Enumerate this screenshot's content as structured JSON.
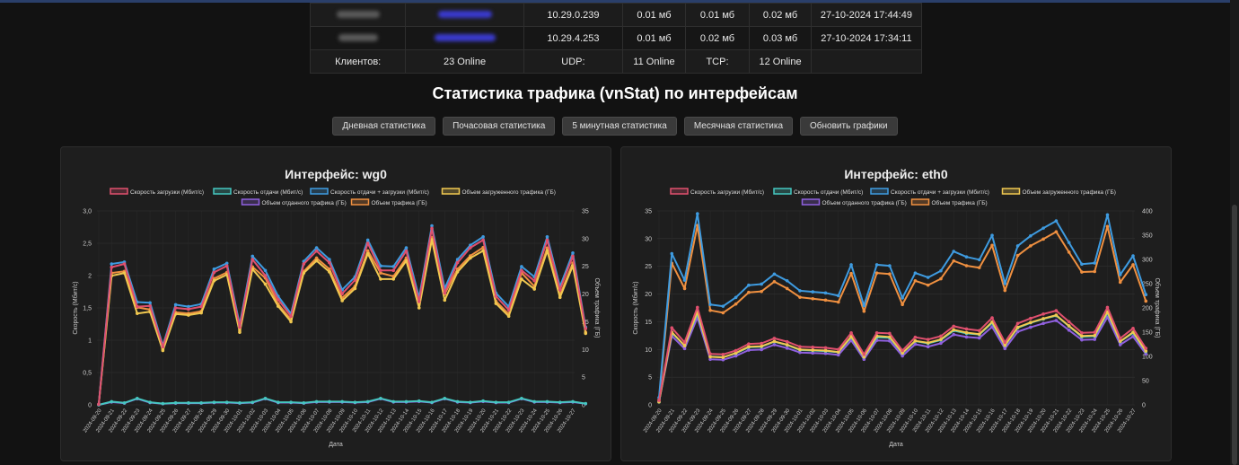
{
  "clients_table": {
    "rows": [
      {
        "ip": "10.29.0.239",
        "download": "0.01 мб",
        "upload": "0.01 мб",
        "total": "0.02 мб",
        "last_seen": "27-10-2024 17:44:49"
      },
      {
        "ip": "10.29.4.253",
        "download": "0.01 мб",
        "upload": "0.02 мб",
        "total": "0.03 мб",
        "last_seen": "27-10-2024 17:34:11"
      }
    ],
    "summary": {
      "clients_label": "Клиентов:",
      "clients_value": "23 Online",
      "udp_label": "UDP:",
      "udp_value": "11 Online",
      "tcp_label": "TCP:",
      "tcp_value": "12 Online"
    }
  },
  "section_title": "Статистика трафика (vnStat) по интерфейсам",
  "buttons": {
    "daily": "Дневная статистика",
    "hourly": "Почасовая статистика",
    "five_min": "5 минутная статистика",
    "monthly": "Месячная статистика",
    "refresh": "Обновить графики"
  },
  "colors": {
    "download": "#e0506e",
    "upload": "#45c7c0",
    "total_speed": "#3e9be0",
    "vol_download": "#f0c850",
    "vol_upload": "#9060e0",
    "vol_total": "#f09040"
  },
  "chart_data": [
    {
      "type": "line",
      "title": "Интерфейс: wg0",
      "xlabel": "Дата",
      "ylabel": "Скорость (Мбит/с)",
      "y2label": "Объем трафика (ГБ)",
      "ylim": [
        0,
        3.0
      ],
      "y2lim": [
        0,
        35
      ],
      "yticks": [
        "0",
        "0,5",
        "1",
        "1,5",
        "2",
        "2,5",
        "3,0"
      ],
      "y2ticks": [
        "0",
        "5",
        "10",
        "15",
        "20",
        "25",
        "30",
        "35"
      ],
      "legend": "top",
      "categories": [
        "2024-09-20",
        "2024-09-21",
        "2024-09-22",
        "2024-09-23",
        "2024-09-24",
        "2024-09-25",
        "2024-09-26",
        "2024-09-27",
        "2024-09-28",
        "2024-09-29",
        "2024-09-30",
        "2024-10-01",
        "2024-10-02",
        "2024-10-03",
        "2024-10-04",
        "2024-10-05",
        "2024-10-06",
        "2024-10-07",
        "2024-10-08",
        "2024-10-09",
        "2024-10-10",
        "2024-10-11",
        "2024-10-12",
        "2024-10-13",
        "2024-10-14",
        "2024-10-15",
        "2024-10-16",
        "2024-10-17",
        "2024-10-18",
        "2024-10-19",
        "2024-10-20",
        "2024-10-21",
        "2024-10-22",
        "2024-10-23",
        "2024-10-24",
        "2024-10-25",
        "2024-10-26",
        "2024-10-27"
      ],
      "series": [
        {
          "name": "Скорость загрузки (Мбит/с)",
          "axis": "left",
          "color": "#e0506e",
          "values": [
            0.01,
            2.13,
            2.18,
            1.52,
            1.53,
            0.9,
            1.5,
            1.48,
            1.52,
            2.05,
            2.15,
            1.2,
            2.25,
            2.0,
            1.63,
            1.37,
            2.18,
            2.38,
            2.2,
            1.72,
            1.93,
            2.5,
            2.08,
            2.08,
            2.38,
            1.6,
            2.73,
            1.73,
            2.2,
            2.43,
            2.55,
            1.68,
            1.47,
            2.08,
            1.92,
            2.55,
            1.78,
            2.3,
            1.18
          ]
        },
        {
          "name": "Скорость отдачи (Мбит/с)",
          "axis": "left",
          "color": "#45c7c0",
          "values": [
            0.0,
            0.05,
            0.03,
            0.1,
            0.04,
            0.02,
            0.03,
            0.03,
            0.03,
            0.04,
            0.04,
            0.03,
            0.04,
            0.1,
            0.04,
            0.04,
            0.03,
            0.05,
            0.05,
            0.05,
            0.04,
            0.05,
            0.1,
            0.05,
            0.05,
            0.06,
            0.04,
            0.1,
            0.05,
            0.04,
            0.06,
            0.04,
            0.04,
            0.1,
            0.05,
            0.05,
            0.04,
            0.05,
            0.02
          ]
        },
        {
          "name": "Скорость отдачи + загрузки (Мбит/с)",
          "axis": "left",
          "color": "#3e9be0",
          "values": [
            0.01,
            2.18,
            2.21,
            1.59,
            1.58,
            0.92,
            1.55,
            1.52,
            1.56,
            2.1,
            2.19,
            1.24,
            2.3,
            2.08,
            1.68,
            1.41,
            2.22,
            2.43,
            2.25,
            1.78,
            1.98,
            2.55,
            2.15,
            2.14,
            2.43,
            1.66,
            2.77,
            1.8,
            2.25,
            2.47,
            2.6,
            1.73,
            1.52,
            2.14,
            1.98,
            2.6,
            1.83,
            2.35,
            1.2
          ]
        },
        {
          "name": "Объем загруженного трафика (ГБ)",
          "axis": "right",
          "color": "#f0c850",
          "values": [
            0.1,
            23.3,
            23.8,
            16.5,
            16.8,
            9.8,
            16.4,
            16.2,
            16.6,
            22.4,
            23.5,
            13.1,
            24.5,
            21.8,
            17.8,
            15.0,
            23.8,
            26.0,
            24.0,
            18.8,
            21.0,
            27.3,
            22.7,
            22.7,
            26.0,
            17.5,
            29.8,
            18.9,
            24.0,
            26.5,
            27.8,
            18.3,
            16.0,
            22.7,
            20.9,
            27.8,
            19.4,
            25.1,
            12.9
          ]
        },
        {
          "name": "Объем отданного трафика (ГБ)",
          "axis": "right",
          "color": "#9060e0",
          "values": [
            0.0,
            0.5,
            0.3,
            1.1,
            0.4,
            0.2,
            0.3,
            0.3,
            0.3,
            0.4,
            0.4,
            0.3,
            0.4,
            1.1,
            0.4,
            0.4,
            0.3,
            0.5,
            0.5,
            0.5,
            0.4,
            0.5,
            1.1,
            0.5,
            0.5,
            0.6,
            0.4,
            1.1,
            0.5,
            0.4,
            0.6,
            0.4,
            0.4,
            1.1,
            0.5,
            0.5,
            0.4,
            0.5,
            0.2
          ]
        },
        {
          "name": "Объем трафика (ГБ)",
          "axis": "right",
          "color": "#f09040",
          "values": [
            0.1,
            23.8,
            24.1,
            17.6,
            17.2,
            10.0,
            16.7,
            16.5,
            16.9,
            22.8,
            23.9,
            13.4,
            24.9,
            22.9,
            18.2,
            15.4,
            24.1,
            26.5,
            24.5,
            19.3,
            21.4,
            27.8,
            23.8,
            23.2,
            26.5,
            18.1,
            30.2,
            20.0,
            24.5,
            26.9,
            28.4,
            18.7,
            16.4,
            23.8,
            21.4,
            28.3,
            19.8,
            25.6,
            13.1
          ]
        }
      ]
    },
    {
      "type": "line",
      "title": "Интерфейс: eth0",
      "xlabel": "Дата",
      "ylabel": "Скорость (Мбит/с)",
      "y2label": "Объем трафика (ГБ)",
      "ylim": [
        0,
        35
      ],
      "y2lim": [
        0,
        400
      ],
      "yticks": [
        "0",
        "5",
        "10",
        "15",
        "20",
        "25",
        "30",
        "35"
      ],
      "y2ticks": [
        "0",
        "50",
        "100",
        "150",
        "200",
        "250",
        "300",
        "350",
        "400"
      ],
      "legend": "top",
      "categories": [
        "2024-09-20",
        "2024-09-21",
        "2024-09-22",
        "2024-09-23",
        "2024-09-24",
        "2024-09-25",
        "2024-09-26",
        "2024-09-27",
        "2024-09-28",
        "2024-09-29",
        "2024-09-30",
        "2024-10-01",
        "2024-10-02",
        "2024-10-03",
        "2024-10-04",
        "2024-10-05",
        "2024-10-06",
        "2024-10-07",
        "2024-10-08",
        "2024-10-09",
        "2024-10-10",
        "2024-10-11",
        "2024-10-12",
        "2024-10-13",
        "2024-10-14",
        "2024-10-15",
        "2024-10-16",
        "2024-10-17",
        "2024-10-18",
        "2024-10-19",
        "2024-10-20",
        "2024-10-21",
        "2024-10-22",
        "2024-10-23",
        "2024-10-24",
        "2024-10-25",
        "2024-10-26",
        "2024-10-27"
      ],
      "series": [
        {
          "name": "Скорость загрузки (Мбит/с)",
          "axis": "left",
          "color": "#e0506e",
          "values": [
            0.8,
            13.9,
            11.3,
            17.6,
            9.2,
            9.1,
            9.8,
            11.0,
            11.1,
            12.0,
            11.4,
            10.5,
            10.4,
            10.3,
            10.0,
            13.0,
            9.1,
            13.0,
            12.9,
            9.8,
            12.2,
            11.8,
            12.4,
            14.2,
            13.7,
            13.4,
            15.7,
            11.3,
            14.7,
            15.6,
            16.4,
            17.0,
            15.0,
            13.0,
            13.1,
            17.6,
            12.0,
            13.8,
            10.2
          ]
        },
        {
          "name": "Скорость отдачи (Мбит/с)",
          "axis": "left",
          "color": "#45c7c0",
          "values": [
            0.5,
            13.0,
            10.7,
            16.5,
            8.7,
            8.6,
            9.3,
            10.4,
            10.5,
            11.4,
            10.8,
            9.9,
            9.8,
            9.7,
            9.5,
            12.2,
            8.6,
            12.2,
            12.1,
            9.3,
            11.5,
            11.1,
            11.7,
            13.4,
            12.9,
            12.7,
            14.8,
            10.7,
            13.9,
            14.8,
            15.5,
            16.1,
            14.2,
            12.3,
            12.4,
            16.6,
            11.4,
            13.0,
            9.6
          ]
        },
        {
          "name": "Скорость отдачи + загрузки (Мбит/с)",
          "axis": "left",
          "color": "#3e9be0",
          "values": [
            1.3,
            27.3,
            22.5,
            34.5,
            18.1,
            17.8,
            19.4,
            21.6,
            21.8,
            23.6,
            22.4,
            20.6,
            20.4,
            20.2,
            19.7,
            25.3,
            17.9,
            25.3,
            25.1,
            19.3,
            23.8,
            23.0,
            24.2,
            27.7,
            26.7,
            26.2,
            30.6,
            21.9,
            28.7,
            30.5,
            31.9,
            33.2,
            29.3,
            25.4,
            25.6,
            34.3,
            23.5,
            26.9,
            19.9
          ]
        },
        {
          "name": "Объем загруженного трафика (ГБ)",
          "axis": "right",
          "color": "#f0c850",
          "values": [
            6,
            150,
            122,
            192,
            99,
            98,
            107,
            120,
            121,
            131,
            124,
            114,
            113,
            112,
            109,
            141,
            99,
            142,
            140,
            107,
            132,
            128,
            135,
            155,
            149,
            146,
            171,
            123,
            160,
            170,
            178,
            185,
            163,
            142,
            143,
            192,
            131,
            150,
            111
          ]
        },
        {
          "name": "Объем отданного трафика (ГБ)",
          "axis": "right",
          "color": "#9060e0",
          "values": [
            6,
            142,
            116,
            180,
            94,
            93,
            101,
            113,
            114,
            124,
            117,
            108,
            107,
            106,
            103,
            133,
            94,
            133,
            132,
            101,
            125,
            120,
            127,
            145,
            140,
            138,
            161,
            116,
            151,
            160,
            168,
            174,
            154,
            134,
            135,
            181,
            124,
            141,
            105
          ]
        },
        {
          "name": "Объем трафика (ГБ)",
          "axis": "right",
          "color": "#f09040",
          "values": [
            10,
            292,
            240,
            370,
            195,
            190,
            208,
            232,
            234,
            254,
            240,
            222,
            219,
            216,
            212,
            271,
            193,
            272,
            270,
            207,
            256,
            247,
            260,
            297,
            287,
            283,
            329,
            236,
            308,
            328,
            342,
            357,
            315,
            274,
            275,
            368,
            253,
            289,
            214
          ]
        }
      ]
    }
  ]
}
